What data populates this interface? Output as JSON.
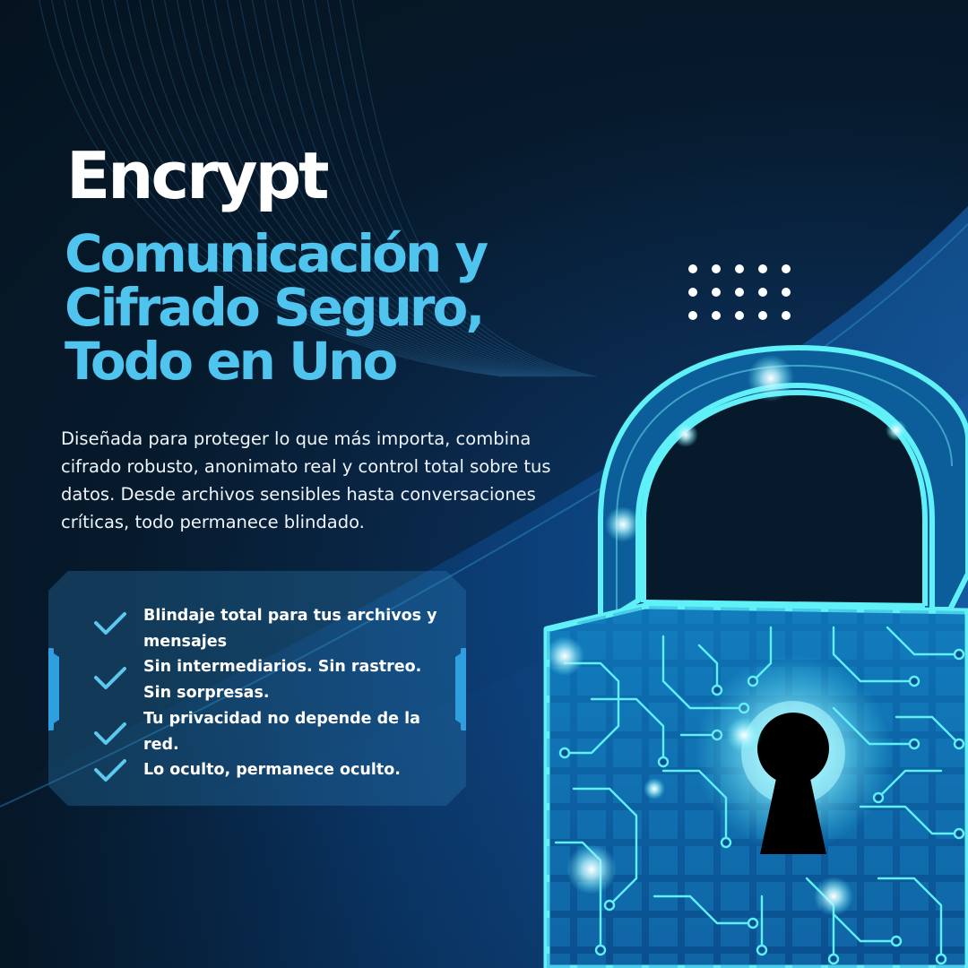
{
  "title": "Encrypt",
  "subtitle": [
    "Comunicación y",
    "Cifrado Seguro,",
    "Todo en Uno"
  ],
  "description": "Diseñada para proteger lo que más importa, combina cifrado robusto, anonimato real y control total sobre tus datos. Desde archivos sensibles hasta conversaciones críticas, todo permanece blindado.",
  "features": [
    {
      "text": "Blindaje total para tus archivos y mensajes",
      "icon": "check-icon"
    },
    {
      "text": "Sin intermediarios. Sin rastreo. Sin sorpresas.",
      "icon": "check-icon"
    },
    {
      "text": "Tu privacidad no depende de la red.",
      "icon": "check-icon"
    },
    {
      "text": "Lo oculto, permanece oculto.",
      "icon": "check-icon"
    }
  ],
  "colors": {
    "background": "#061a2c",
    "accent_cyan": "#4ec4ee",
    "neon": "#5ff0f8",
    "lock_fill": "#0e6fb0",
    "title_white": "#ffffff"
  },
  "decorations": {
    "dot_grid": "white-dot-grid",
    "padlock": "circuit-padlock-icon",
    "keyhole": "keyhole-icon"
  }
}
